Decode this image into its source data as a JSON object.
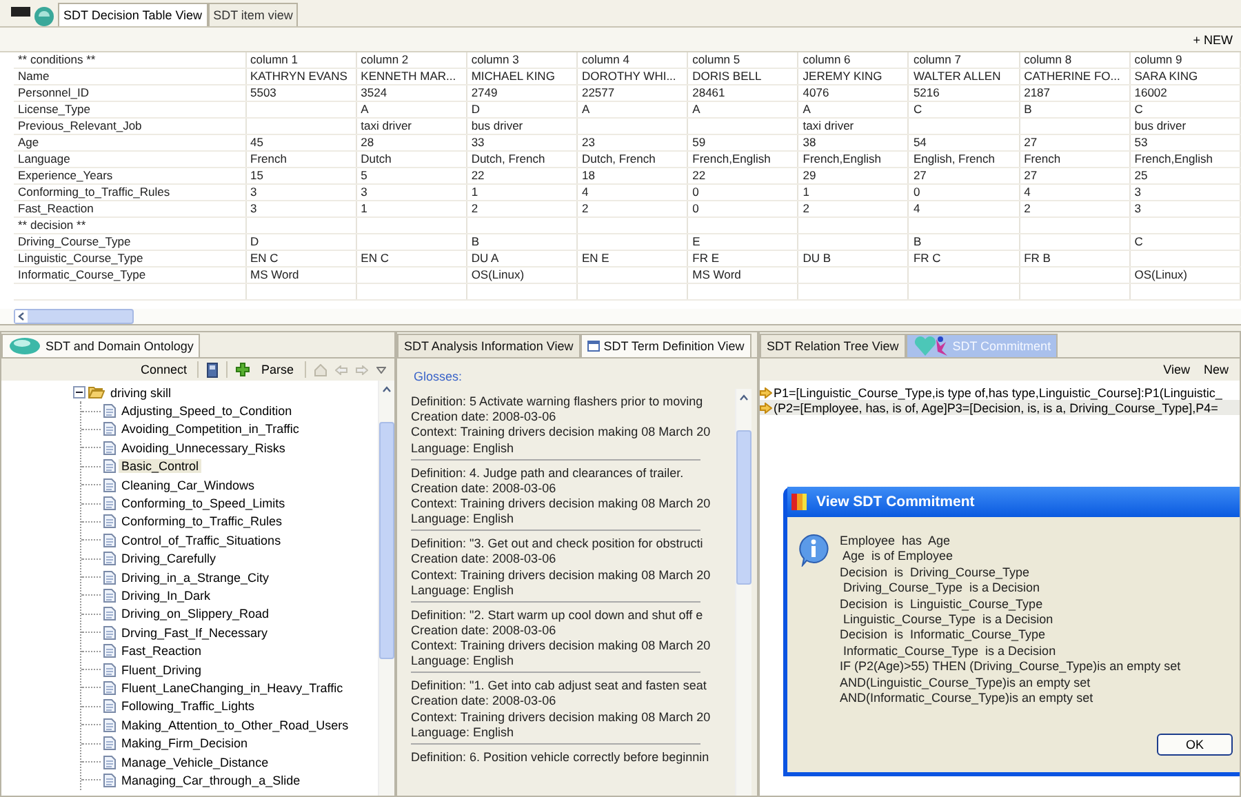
{
  "top_tabs": [
    {
      "label": "SDT Decision Table View",
      "selected": true
    },
    {
      "label": "SDT item view",
      "selected": false
    }
  ],
  "table_toolbar": {
    "new_button": "+ NEW"
  },
  "table": {
    "columns": [
      "** conditions **",
      "column 1",
      "column 2",
      "column 3",
      "column 4",
      "column 5",
      "column 6",
      "column 7",
      "column 8",
      "column 9"
    ],
    "rows": [
      {
        "cells": [
          "Name",
          "KATHRYN EVANS",
          "KENNETH MAR...",
          "MICHAEL KING",
          "DOROTHY WHI...",
          "DORIS BELL",
          "JEREMY KING",
          "WALTER ALLEN",
          "CATHERINE FO...",
          "SARA KING"
        ]
      },
      {
        "cells": [
          "Personnel_ID",
          "5503",
          "3524",
          "2749",
          "22577",
          "28461",
          "4076",
          "5216",
          "2187",
          "16002"
        ]
      },
      {
        "cells": [
          "License_Type",
          null,
          "A",
          "D",
          "A",
          "A",
          "A",
          "C",
          "B",
          "C"
        ]
      },
      {
        "cells": [
          "Previous_Relevant_Job",
          null,
          "taxi driver",
          "bus driver",
          null,
          null,
          "taxi driver",
          null,
          null,
          "bus driver"
        ]
      },
      {
        "cells": [
          "Age",
          "45",
          "28",
          "33",
          "23",
          "59",
          "38",
          "54",
          "27",
          "53"
        ]
      },
      {
        "cells": [
          "Language",
          "French",
          "Dutch",
          "Dutch, French",
          "Dutch, French",
          "French,English",
          "French,English",
          "English, French",
          "French",
          "French,English"
        ]
      },
      {
        "cells": [
          "Experience_Years",
          "15",
          "5",
          "22",
          "18",
          "22",
          "29",
          "27",
          "27",
          "25"
        ]
      },
      {
        "cells": [
          "Conforming_to_Traffic_Rules",
          "3",
          "3",
          "1",
          "4",
          "0",
          "1",
          "0",
          "4",
          "3"
        ]
      },
      {
        "cells": [
          "Fast_Reaction",
          "3",
          "1",
          "2",
          "2",
          "0",
          "2",
          "4",
          "2",
          "3"
        ]
      },
      {
        "cells": [
          "** decision **",
          null,
          null,
          null,
          null,
          null,
          null,
          null,
          null,
          null
        ]
      },
      {
        "cells": [
          "Driving_Course_Type",
          "D",
          null,
          "B",
          null,
          "E",
          null,
          "B",
          null,
          "C"
        ]
      },
      {
        "cells": [
          "Linguistic_Course_Type",
          "EN C",
          "EN C",
          "DU A",
          "EN E",
          "FR E",
          "DU B",
          "FR C",
          "FR B",
          null
        ]
      },
      {
        "cells": [
          "Informatic_Course_Type",
          "MS Word",
          null,
          "OS(Linux)",
          null,
          "MS Word",
          null,
          null,
          null,
          "OS(Linux)"
        ]
      }
    ]
  },
  "ontology_panel": {
    "tab": "SDT and Domain Ontology",
    "toolbar": {
      "connect": "Connect",
      "parse": "Parse"
    },
    "tree": [
      {
        "label": "driving skill",
        "expanded": true,
        "children": [
          {
            "label": "Adjusting_Speed_to_Condition",
            "selected": false
          },
          {
            "label": "Avoiding_Competition_in_Traffic",
            "selected": false
          },
          {
            "label": "Avoiding_Unnecessary_Risks",
            "selected": false
          },
          {
            "label": "Basic_Control",
            "selected": true
          },
          {
            "label": "Cleaning_Car_Windows",
            "selected": false
          },
          {
            "label": "Conforming_to_Speed_Limits",
            "selected": false
          },
          {
            "label": "Conforming_to_Traffic_Rules",
            "selected": false
          },
          {
            "label": "Control_of_Traffic_Situations",
            "selected": false
          },
          {
            "label": "Driving_Carefully",
            "selected": false
          },
          {
            "label": "Driving_in_a_Strange_City",
            "selected": false
          },
          {
            "label": "Driving_In_Dark",
            "selected": false
          },
          {
            "label": "Driving_on_Slippery_Road",
            "selected": false
          },
          {
            "label": "Drving_Fast_If_Necessary",
            "selected": false
          },
          {
            "label": "Fast_Reaction",
            "selected": false
          },
          {
            "label": "Fluent_Driving",
            "selected": false
          },
          {
            "label": "Fluent_LaneChanging_in_Heavy_Traffic",
            "selected": false
          },
          {
            "label": "Following_Traffic_Lights",
            "selected": false
          },
          {
            "label": "Making_Attention_to_Other_Road_Users",
            "selected": false
          },
          {
            "label": "Making_Firm_Decision",
            "selected": false
          },
          {
            "label": "Manage_Vehicle_Distance",
            "selected": false
          },
          {
            "label": "Managing_Car_through_a_Slide",
            "selected": false
          }
        ]
      }
    ]
  },
  "definition_panel": {
    "tabs": [
      {
        "label": "SDT Analysis Information View",
        "selected": false
      },
      {
        "label": "SDT Term Definition View",
        "selected": true
      }
    ],
    "group_title": "Glosses:",
    "glosses": [
      {
        "definition": "Definition: 5 Activate warning flashers prior to moving",
        "creation_date": "Creation date: 2008-03-06",
        "context": "Context: Training drivers decision making 08 March 20",
        "language": "Language: English"
      },
      {
        "definition": "Definition: 4. Judge path and clearances of trailer.",
        "creation_date": "Creation date: 2008-03-06",
        "context": "Context: Training drivers decision making 08 March 20",
        "language": "Language: English"
      },
      {
        "definition": "Definition: \"3. Get out and check position for obstructi",
        "creation_date": "Creation date: 2008-03-06",
        "context": "Context: Training drivers decision making 08 March 20",
        "language": "Language: English"
      },
      {
        "definition": "Definition: \"2. Start warm up cool down and shut off e",
        "creation_date": "Creation date: 2008-03-06",
        "context": "Context: Training drivers decision making 08 March 20",
        "language": "Language: English"
      },
      {
        "definition": "Definition: \"1. Get into cab adjust seat and fasten seat",
        "creation_date": "Creation date: 2008-03-06",
        "context": "Context: Training drivers decision making 08 March 20",
        "language": "Language: English"
      },
      {
        "definition": "Definition: 6. Position vehicle correctly before beginnin"
      }
    ]
  },
  "relation_panel": {
    "tabs": [
      {
        "label": "SDT Relation Tree View",
        "selected": false
      },
      {
        "label": "SDT Commitment",
        "selected": true
      }
    ],
    "toolbar": [
      "View",
      "New"
    ],
    "relations": [
      {
        "text": "P1=[Linguistic_Course_Type,is type of,has type,Linguistic_Course]:P1(Linguistic_",
        "selected": false
      },
      {
        "text": "(P2=[Employee, has, is of, Age]P3=[Decision, is, is a, Driving_Course_Type],P4=",
        "selected": true
      }
    ]
  },
  "dialog": {
    "title": "View SDT Commitment",
    "lines": [
      "Employee  has  Age",
      " Age  is of Employee",
      "Decision  is  Driving_Course_Type",
      " Driving_Course_Type  is a Decision",
      "Decision  is  Linguistic_Course_Type",
      " Linguistic_Course_Type  is a Decision",
      "Decision  is  Informatic_Course_Type",
      " Informatic_Course_Type  is a Decision",
      "IF (P2(Age)>55) THEN (Driving_Course_Type)is an empty set",
      "AND(Linguistic_Course_Type)is an empty set",
      "AND(Informatic_Course_Type)is an empty set"
    ],
    "ok_button": "OK"
  }
}
